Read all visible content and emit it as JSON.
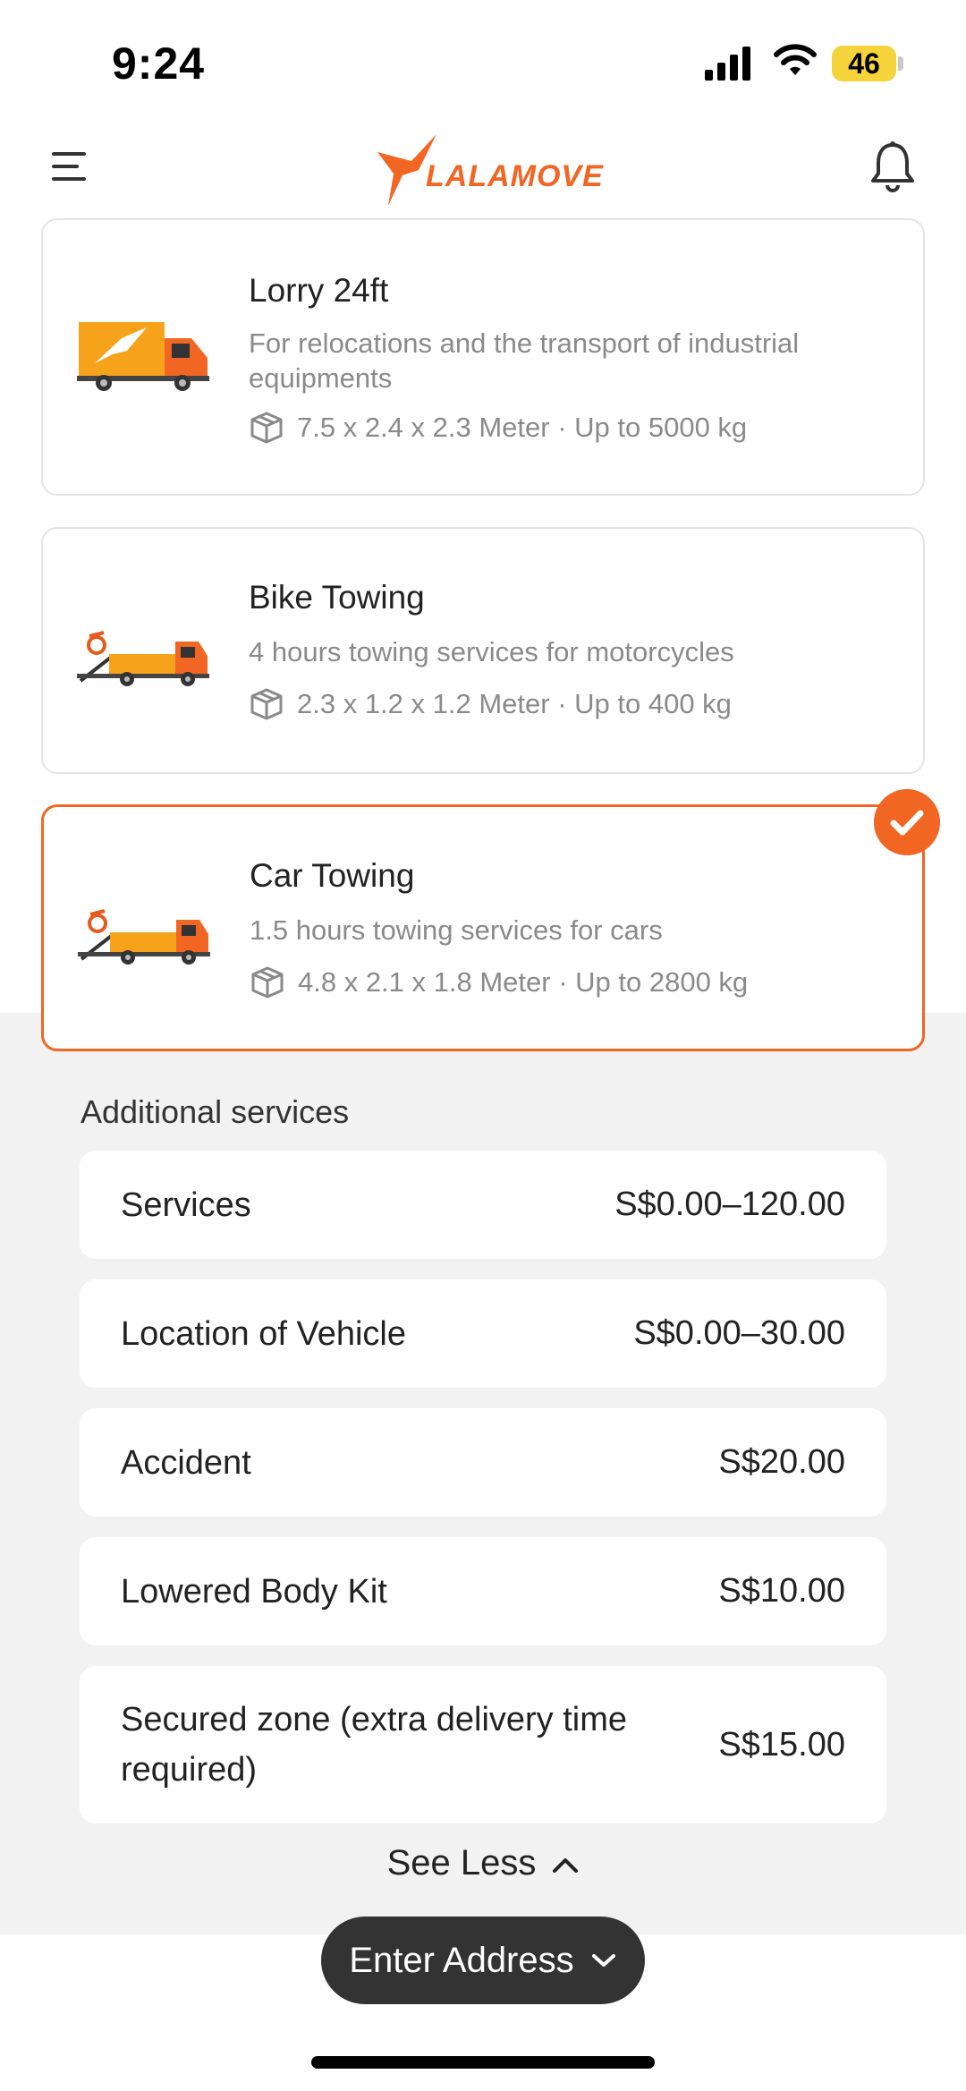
{
  "status": {
    "time": "9:24",
    "battery": "46"
  },
  "header": {
    "logo_text": "LALAMOVE",
    "logo_icon": "bird-icon",
    "menu_icon": "hamburger-menu-icon",
    "notification_icon": "bell-icon"
  },
  "vehicles": [
    {
      "title": "Lorry 24ft",
      "description": "For relocations and the transport of industrial equipments",
      "spec": "7.5 x 2.4 x 2.3 Meter · Up to 5000 kg",
      "selected": false
    },
    {
      "title": "Bike Towing",
      "description": "4 hours towing services for motorcycles",
      "spec": "2.3 x 1.2 x 1.2 Meter · Up to 400 kg",
      "selected": false
    },
    {
      "title": "Car Towing",
      "description": "1.5 hours towing services for cars",
      "spec": "4.8 x 2.1 x 1.8 Meter · Up to 2800 kg",
      "selected": true
    }
  ],
  "additional": {
    "title": "Additional services",
    "services": [
      {
        "label": "Services",
        "price": "S$0.00–120.00"
      },
      {
        "label": "Location of Vehicle",
        "price": "S$0.00–30.00"
      },
      {
        "label": "Accident",
        "price": "S$20.00"
      },
      {
        "label": "Lowered Body Kit",
        "price": "S$10.00"
      },
      {
        "label": "Secured zone (extra delivery time required)",
        "price": "S$15.00"
      }
    ],
    "see_less": "See Less"
  },
  "footer": {
    "enter_address": "Enter Address"
  },
  "colors": {
    "accent": "#f16623",
    "dark": "#333333",
    "background_grey": "#f2f2f2"
  }
}
